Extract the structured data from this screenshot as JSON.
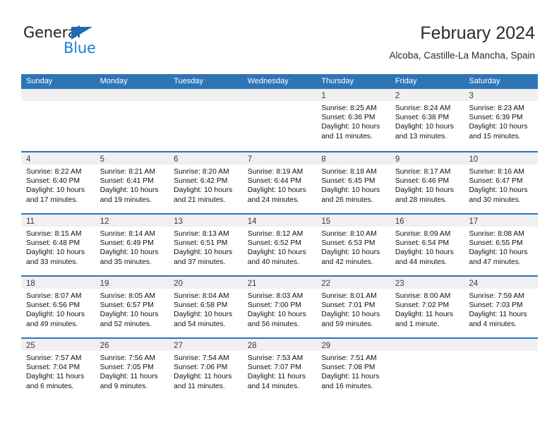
{
  "brand": {
    "name_part1": "General",
    "name_part2": "Blue",
    "logo_icon": "triangle-logo-icon",
    "color_dark": "#231f20",
    "color_blue": "#1b82d2"
  },
  "header": {
    "title": "February 2024",
    "subtitle": "Alcoba, Castille-La Mancha, Spain"
  },
  "theme": {
    "header_bg": "#2e75b6",
    "header_text": "#ffffff",
    "daynum_band": "#f0f0f0",
    "row_divider": "#2e75b6"
  },
  "calendar": {
    "weekday_headers": [
      "Sunday",
      "Monday",
      "Tuesday",
      "Wednesday",
      "Thursday",
      "Friday",
      "Saturday"
    ],
    "weeks": [
      [
        {
          "day": "",
          "lines": []
        },
        {
          "day": "",
          "lines": []
        },
        {
          "day": "",
          "lines": []
        },
        {
          "day": "",
          "lines": []
        },
        {
          "day": "1",
          "lines": [
            "Sunrise: 8:25 AM",
            "Sunset: 6:36 PM",
            "Daylight: 10 hours",
            "and 11 minutes."
          ]
        },
        {
          "day": "2",
          "lines": [
            "Sunrise: 8:24 AM",
            "Sunset: 6:38 PM",
            "Daylight: 10 hours",
            "and 13 minutes."
          ]
        },
        {
          "day": "3",
          "lines": [
            "Sunrise: 8:23 AM",
            "Sunset: 6:39 PM",
            "Daylight: 10 hours",
            "and 15 minutes."
          ]
        }
      ],
      [
        {
          "day": "4",
          "lines": [
            "Sunrise: 8:22 AM",
            "Sunset: 6:40 PM",
            "Daylight: 10 hours",
            "and 17 minutes."
          ]
        },
        {
          "day": "5",
          "lines": [
            "Sunrise: 8:21 AM",
            "Sunset: 6:41 PM",
            "Daylight: 10 hours",
            "and 19 minutes."
          ]
        },
        {
          "day": "6",
          "lines": [
            "Sunrise: 8:20 AM",
            "Sunset: 6:42 PM",
            "Daylight: 10 hours",
            "and 21 minutes."
          ]
        },
        {
          "day": "7",
          "lines": [
            "Sunrise: 8:19 AM",
            "Sunset: 6:44 PM",
            "Daylight: 10 hours",
            "and 24 minutes."
          ]
        },
        {
          "day": "8",
          "lines": [
            "Sunrise: 8:18 AM",
            "Sunset: 6:45 PM",
            "Daylight: 10 hours",
            "and 26 minutes."
          ]
        },
        {
          "day": "9",
          "lines": [
            "Sunrise: 8:17 AM",
            "Sunset: 6:46 PM",
            "Daylight: 10 hours",
            "and 28 minutes."
          ]
        },
        {
          "day": "10",
          "lines": [
            "Sunrise: 8:16 AM",
            "Sunset: 6:47 PM",
            "Daylight: 10 hours",
            "and 30 minutes."
          ]
        }
      ],
      [
        {
          "day": "11",
          "lines": [
            "Sunrise: 8:15 AM",
            "Sunset: 6:48 PM",
            "Daylight: 10 hours",
            "and 33 minutes."
          ]
        },
        {
          "day": "12",
          "lines": [
            "Sunrise: 8:14 AM",
            "Sunset: 6:49 PM",
            "Daylight: 10 hours",
            "and 35 minutes."
          ]
        },
        {
          "day": "13",
          "lines": [
            "Sunrise: 8:13 AM",
            "Sunset: 6:51 PM",
            "Daylight: 10 hours",
            "and 37 minutes."
          ]
        },
        {
          "day": "14",
          "lines": [
            "Sunrise: 8:12 AM",
            "Sunset: 6:52 PM",
            "Daylight: 10 hours",
            "and 40 minutes."
          ]
        },
        {
          "day": "15",
          "lines": [
            "Sunrise: 8:10 AM",
            "Sunset: 6:53 PM",
            "Daylight: 10 hours",
            "and 42 minutes."
          ]
        },
        {
          "day": "16",
          "lines": [
            "Sunrise: 8:09 AM",
            "Sunset: 6:54 PM",
            "Daylight: 10 hours",
            "and 44 minutes."
          ]
        },
        {
          "day": "17",
          "lines": [
            "Sunrise: 8:08 AM",
            "Sunset: 6:55 PM",
            "Daylight: 10 hours",
            "and 47 minutes."
          ]
        }
      ],
      [
        {
          "day": "18",
          "lines": [
            "Sunrise: 8:07 AM",
            "Sunset: 6:56 PM",
            "Daylight: 10 hours",
            "and 49 minutes."
          ]
        },
        {
          "day": "19",
          "lines": [
            "Sunrise: 8:05 AM",
            "Sunset: 6:57 PM",
            "Daylight: 10 hours",
            "and 52 minutes."
          ]
        },
        {
          "day": "20",
          "lines": [
            "Sunrise: 8:04 AM",
            "Sunset: 6:58 PM",
            "Daylight: 10 hours",
            "and 54 minutes."
          ]
        },
        {
          "day": "21",
          "lines": [
            "Sunrise: 8:03 AM",
            "Sunset: 7:00 PM",
            "Daylight: 10 hours",
            "and 56 minutes."
          ]
        },
        {
          "day": "22",
          "lines": [
            "Sunrise: 8:01 AM",
            "Sunset: 7:01 PM",
            "Daylight: 10 hours",
            "and 59 minutes."
          ]
        },
        {
          "day": "23",
          "lines": [
            "Sunrise: 8:00 AM",
            "Sunset: 7:02 PM",
            "Daylight: 11 hours",
            "and 1 minute."
          ]
        },
        {
          "day": "24",
          "lines": [
            "Sunrise: 7:59 AM",
            "Sunset: 7:03 PM",
            "Daylight: 11 hours",
            "and 4 minutes."
          ]
        }
      ],
      [
        {
          "day": "25",
          "lines": [
            "Sunrise: 7:57 AM",
            "Sunset: 7:04 PM",
            "Daylight: 11 hours",
            "and 6 minutes."
          ]
        },
        {
          "day": "26",
          "lines": [
            "Sunrise: 7:56 AM",
            "Sunset: 7:05 PM",
            "Daylight: 11 hours",
            "and 9 minutes."
          ]
        },
        {
          "day": "27",
          "lines": [
            "Sunrise: 7:54 AM",
            "Sunset: 7:06 PM",
            "Daylight: 11 hours",
            "and 11 minutes."
          ]
        },
        {
          "day": "28",
          "lines": [
            "Sunrise: 7:53 AM",
            "Sunset: 7:07 PM",
            "Daylight: 11 hours",
            "and 14 minutes."
          ]
        },
        {
          "day": "29",
          "lines": [
            "Sunrise: 7:51 AM",
            "Sunset: 7:08 PM",
            "Daylight: 11 hours",
            "and 16 minutes."
          ]
        },
        {
          "day": "",
          "lines": []
        },
        {
          "day": "",
          "lines": []
        }
      ]
    ]
  }
}
